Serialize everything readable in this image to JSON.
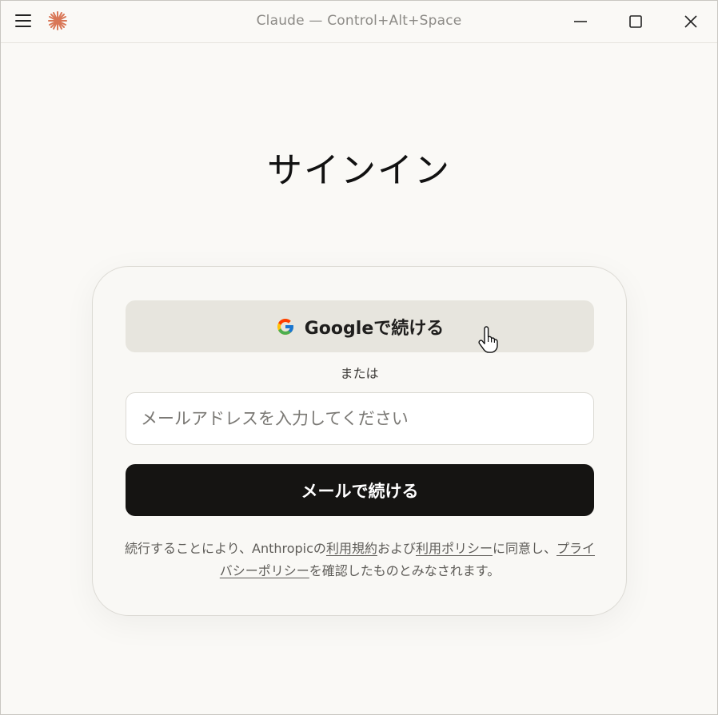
{
  "window": {
    "title": "Claude — Control+Alt+Space"
  },
  "page": {
    "heading": "サインイン"
  },
  "card": {
    "google_button_label": "Googleで続ける",
    "or_text": "または",
    "email_placeholder": "メールアドレスを入力してください",
    "email_value": "",
    "email_button_label": "メールで続ける",
    "terms": {
      "prefix": "続行することにより、Anthropicの",
      "terms_link": "利用規約",
      "and_text": "および",
      "policy_link": "利用ポリシー",
      "agree_text": "に同意し、",
      "privacy_link": "プライバシーポリシー",
      "suffix": "を確認したものとみなされます。"
    }
  },
  "icons": {
    "menu": "hamburger-menu-icon",
    "logo": "claude-logo-icon",
    "minimize": "minimize-icon",
    "maximize": "maximize-icon",
    "close": "close-icon",
    "google": "google-g-icon",
    "cursor": "hand-pointer-cursor-icon"
  },
  "colors": {
    "background": "#faf9f6",
    "logo_accent": "#d97757",
    "google_button_bg": "#e7e5de",
    "primary_button_bg": "#151412",
    "primary_button_text": "#ffffff"
  }
}
